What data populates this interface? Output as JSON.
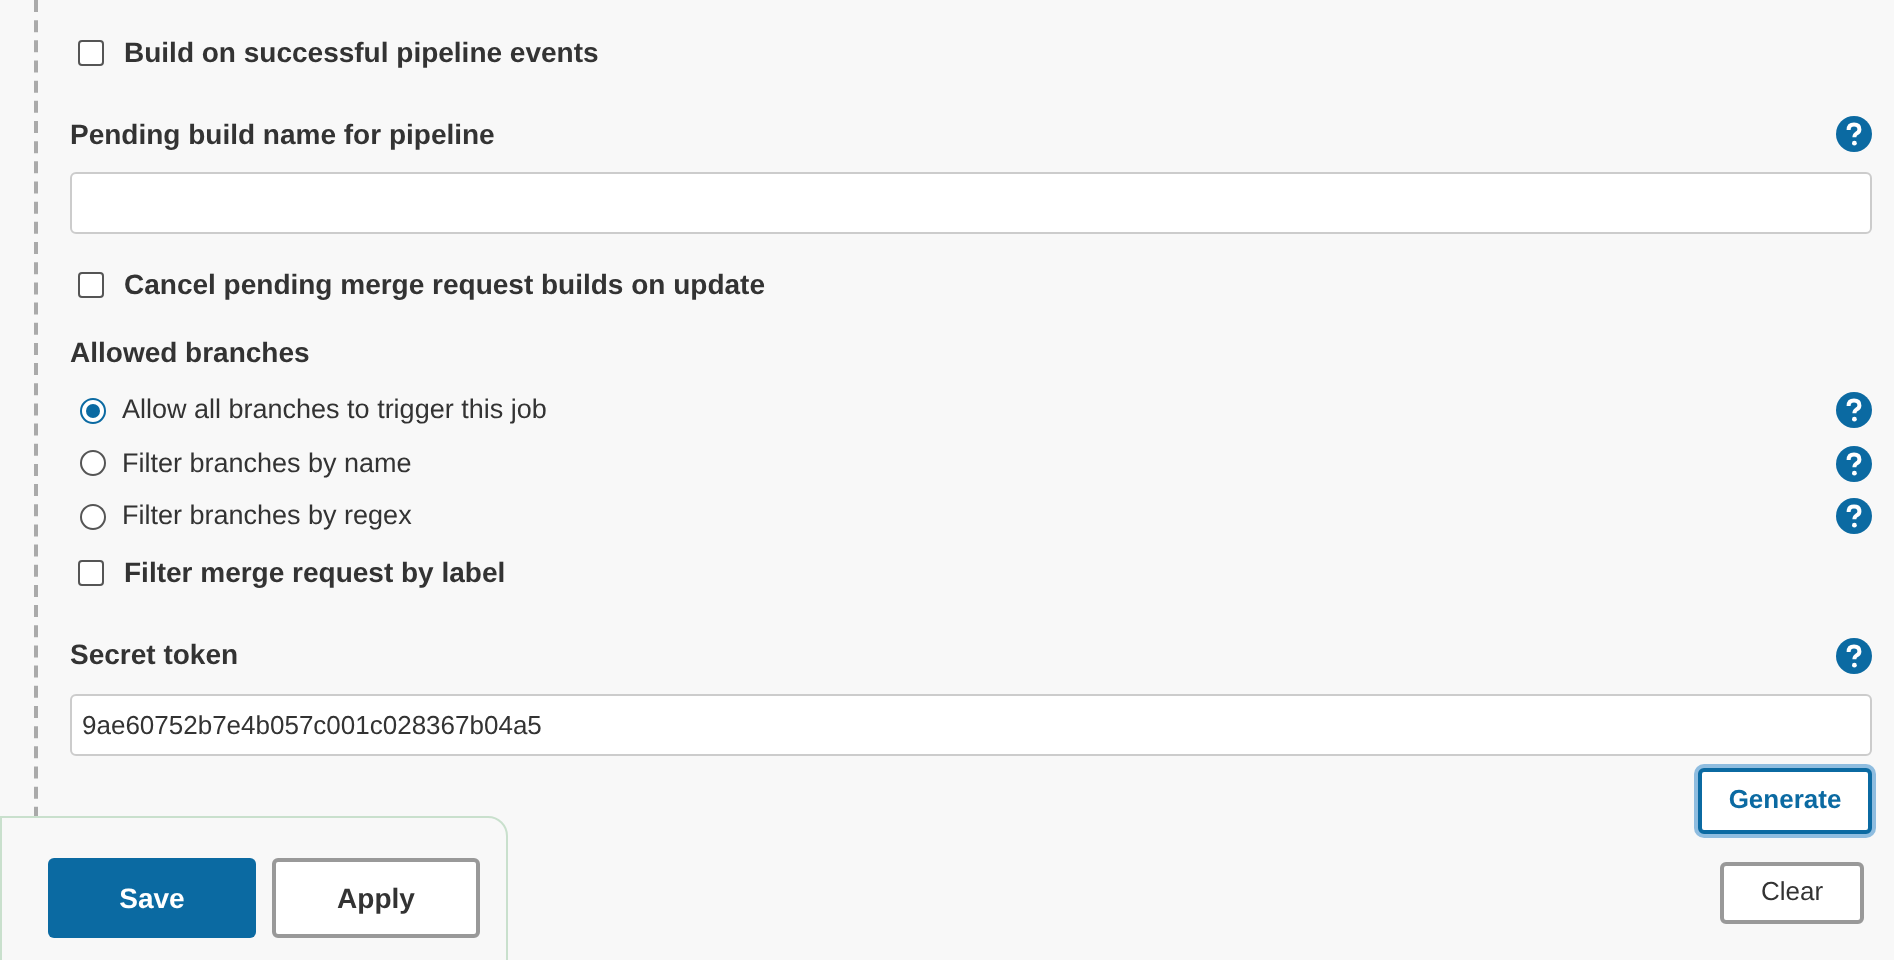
{
  "fields": [
    {
      "kind": "checkbox",
      "label": "Build on successful pipeline events",
      "checked": false
    },
    {
      "kind": "text",
      "label": "Pending build name for pipeline",
      "help": true
    },
    {
      "kind": "checkbox",
      "label": "Cancel pending merge request builds on update",
      "checked": false
    },
    {
      "kind": "radio_group",
      "label": "Allowed branches",
      "options": [
        {
          "label": "Allow all branches to trigger this job",
          "selected": true,
          "help": true
        },
        {
          "label": "Filter branches by name",
          "selected": false,
          "help": true
        },
        {
          "label": "Filter branches by regex",
          "selected": false,
          "help": true
        }
      ]
    },
    {
      "kind": "checkbox",
      "label": "Filter merge request by label",
      "checked": false
    },
    {
      "kind": "text",
      "label": "Secret token",
      "help": true,
      "value": "9ae60752b7e4b057c001c028367b04a5",
      "buttons": [
        "Generate",
        "Clear"
      ]
    }
  ],
  "footer": {
    "buttons": [
      "Save",
      "Apply"
    ]
  }
}
